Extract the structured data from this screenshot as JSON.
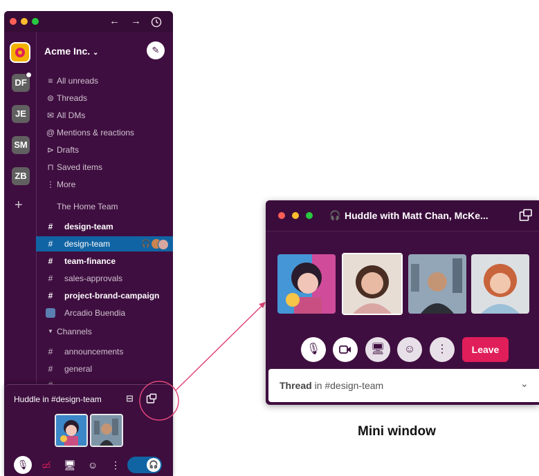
{
  "app": {
    "workspace_name": "Acme Inc.",
    "workspaces": [
      {
        "label": "DF"
      },
      {
        "label": "JE"
      },
      {
        "label": "SM"
      },
      {
        "label": "ZB"
      }
    ],
    "nav": [
      {
        "label": "All unreads",
        "icon": "list-icon"
      },
      {
        "label": "Threads",
        "icon": "threads-icon"
      },
      {
        "label": "All DMs",
        "icon": "dms-icon"
      },
      {
        "label": "Mentions & reactions",
        "icon": "at-icon"
      },
      {
        "label": "Drafts",
        "icon": "drafts-icon"
      },
      {
        "label": "Saved items",
        "icon": "bookmark-icon"
      },
      {
        "label": "More",
        "icon": "more-icon"
      }
    ],
    "section_home_team": "The Home Team",
    "home_channels": [
      {
        "name": "design-team",
        "bold": true
      },
      {
        "name": "design-team",
        "selected": true
      },
      {
        "name": "team-finance",
        "bold": true
      },
      {
        "name": "sales-approvals",
        "bold": false
      },
      {
        "name": "project-brand-campaign",
        "bold": true
      }
    ],
    "dm_name": "Arcadio Buendia",
    "section_channels": "Channels",
    "channels": [
      {
        "name": "announcements"
      },
      {
        "name": "general"
      },
      {
        "name": "..."
      }
    ]
  },
  "huddle_panel": {
    "title": "Huddle in #design-team"
  },
  "mini_window": {
    "title": "Huddle with Matt Chan, McKe...",
    "leave_label": "Leave",
    "thread_prefix": "Thread",
    "thread_in": "in #design-team",
    "caption": "Mini window"
  },
  "colors": {
    "aubergine": "#3f0e40",
    "selected": "#1164a3",
    "leave": "#e01e5a",
    "annotation": "#e0457a"
  }
}
